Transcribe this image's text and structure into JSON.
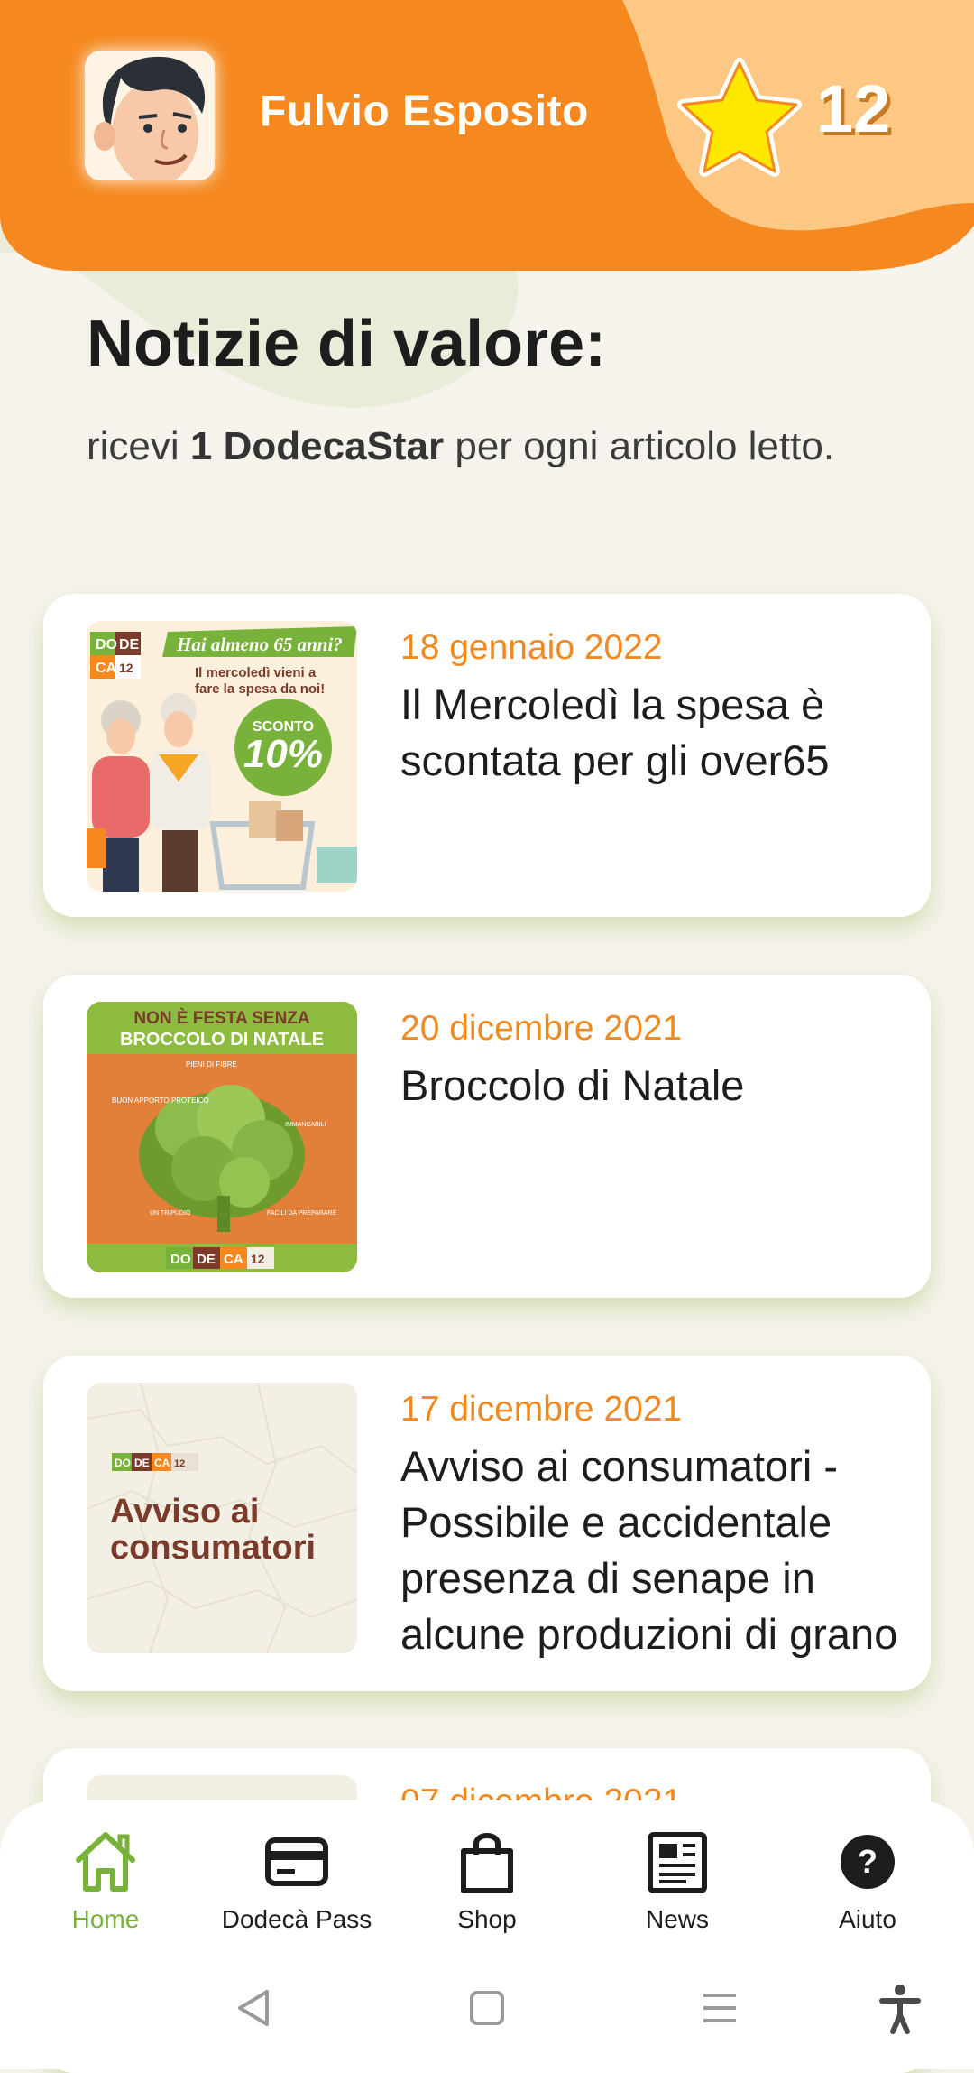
{
  "header": {
    "user_name": "Fulvio Esposito",
    "star_count": "12"
  },
  "main": {
    "title": "Notizie di valore:",
    "subtitle_prefix": "ricevi ",
    "subtitle_bold": "1 DodecaStar",
    "subtitle_suffix": " per ogni articolo letto."
  },
  "articles": [
    {
      "date": "18 gennaio 2022",
      "title": "Il Mercoledì la spesa è scontata per gli over65",
      "thumb": {
        "brand": [
          "DO",
          "DE",
          "CA",
          "12"
        ],
        "headline": "Hai almeno 65 anni?",
        "line1": "Il mercoledì vieni a",
        "line2": "fare la spesa da noi!",
        "badge_label": "SCONTO",
        "badge_value": "10%"
      }
    },
    {
      "date": "20 dicembre 2021",
      "title": "Broccolo di Natale",
      "thumb": {
        "line1": "NON È FESTA SENZA",
        "line2": "BROCCOLO DI NATALE",
        "tag1": "PIENI DI FIBRE",
        "tag2": "BUON APPORTO PROTEICO",
        "tag3": "IMMANCABILI NELL'INSALATA DI RINFORZO",
        "tag4": "UN TRIPUDIO ACCOMPAGNATI ALL'BACCALÀ FRITTO",
        "tag5": "FACILI DA PREPARARE",
        "brand": [
          "DO",
          "DE",
          "CA",
          "12"
        ]
      }
    },
    {
      "date": "17 dicembre 2021",
      "title": "Avviso ai consumatori - Possibile e accidentale presenza di senape in alcune produzioni di grano",
      "thumb": {
        "brand": [
          "DO",
          "DE",
          "CA",
          "12"
        ],
        "line1": "Avviso ai",
        "line2": "consumatori"
      }
    },
    {
      "date": "07 dicembre 2021",
      "title": ""
    }
  ],
  "nav": {
    "items": [
      {
        "label": "Home",
        "icon": "home-icon"
      },
      {
        "label": "Dodecà Pass",
        "icon": "card-icon"
      },
      {
        "label": "Shop",
        "icon": "bag-icon"
      },
      {
        "label": "News",
        "icon": "newspaper-icon"
      },
      {
        "label": "Aiuto",
        "icon": "help-icon"
      }
    ]
  },
  "colors": {
    "accent_orange": "#f5891f",
    "accent_green": "#78b23a",
    "date_orange": "#f0891f"
  }
}
